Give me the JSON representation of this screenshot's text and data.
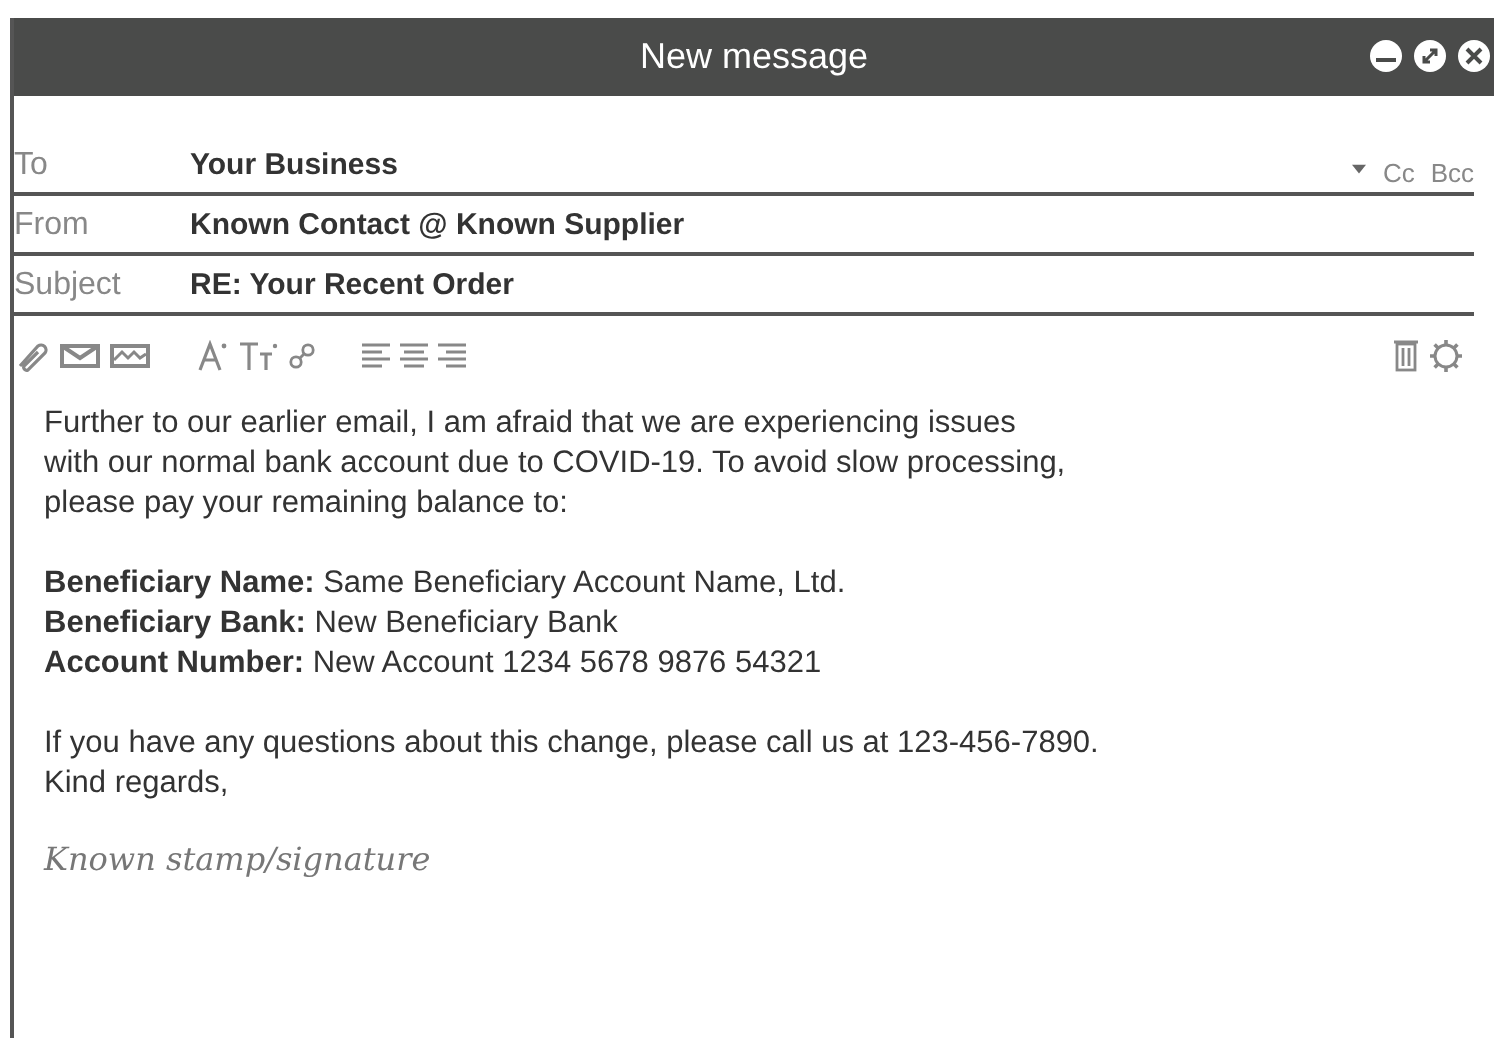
{
  "window": {
    "title": "New message"
  },
  "fields": [
    {
      "label": "To",
      "value": "Your Business",
      "extras": [
        "Cc",
        "Bcc"
      ]
    },
    {
      "label": "From",
      "value": "Known Contact @ Known Supplier"
    },
    {
      "label": "Subject",
      "value": "RE: Your Recent Order"
    }
  ],
  "body": {
    "paragraphs": [
      [
        "Further to our earlier email, I am afraid that we are experiencing issues",
        "with our normal  bank account due to COVID-19. To avoid slow processing,",
        "please pay your remaining balance to:"
      ],
      [
        "**Beneficiary Name:** Same Beneficiary Account Name, Ltd.",
        "**Beneficiary Bank:** New Beneficiary Bank",
        "**Account Number:** New Account 1234 5678 9876 54321"
      ],
      [
        "If you have any questions about this change, please call us at 123-456-7890.",
        "Kind regards,"
      ]
    ],
    "signature": "Known stamp/signature"
  }
}
